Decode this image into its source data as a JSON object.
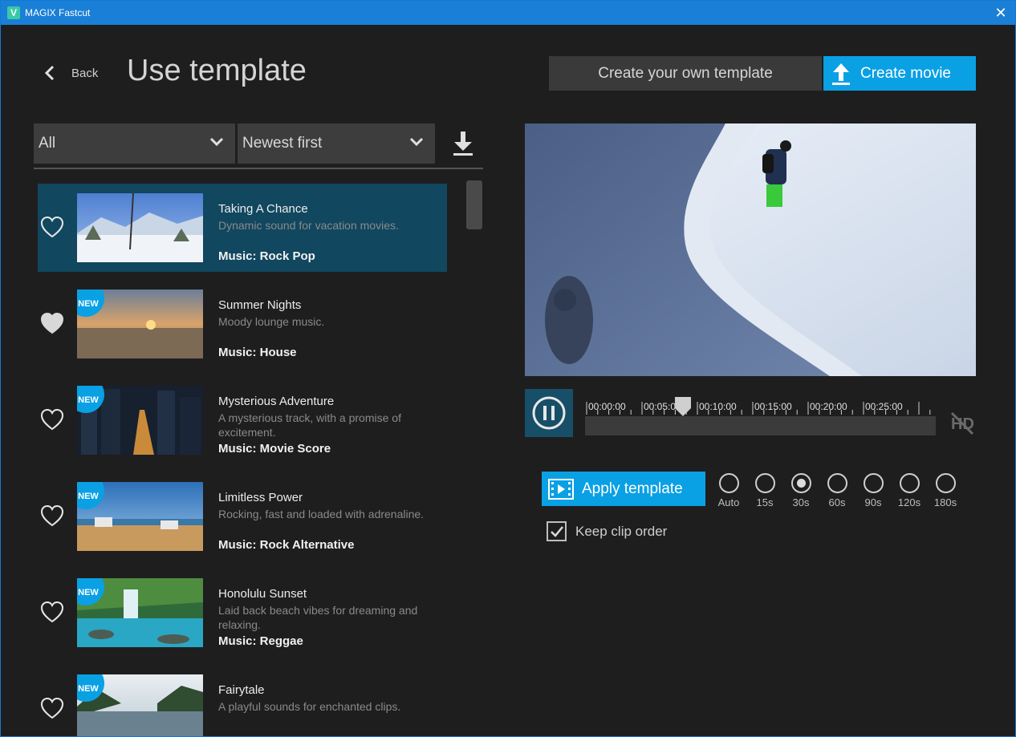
{
  "window": {
    "title": "MAGIX Fastcut",
    "icon_letter": "V",
    "close_glyph": "✕"
  },
  "header": {
    "back_label": "Back",
    "page_title": "Use template",
    "own_template_label": "Create your own template",
    "create_movie_label": "Create movie"
  },
  "filters": {
    "category": "All",
    "sort": "Newest first"
  },
  "templates": [
    {
      "title": "Taking A Chance",
      "desc": "Dynamic sound for vacation movies.",
      "music": "Music: Rock Pop",
      "badge": "",
      "favorite": false,
      "selected": true
    },
    {
      "title": "Summer Nights",
      "desc": "Moody lounge music.",
      "music": "Music: House",
      "badge": "NEW",
      "favorite": true,
      "selected": false
    },
    {
      "title": "Mysterious Adventure",
      "desc": "A mysterious track, with a promise of excitement.",
      "music": "Music: Movie Score",
      "badge": "NEW",
      "favorite": false,
      "selected": false
    },
    {
      "title": "Limitless Power",
      "desc": "Rocking, fast and loaded with adrenaline.",
      "music": "Music: Rock Alternative",
      "badge": "NEW",
      "favorite": false,
      "selected": false
    },
    {
      "title": "Honolulu Sunset",
      "desc": "Laid back beach vibes for dreaming and relaxing.",
      "music": "Music: Reggae",
      "badge": "NEW",
      "favorite": false,
      "selected": false
    },
    {
      "title": "Fairytale",
      "desc": "A playful sounds for enchanted clips.",
      "music": "",
      "badge": "NEW",
      "favorite": false,
      "selected": false
    }
  ],
  "player": {
    "timecodes": [
      "00:00:00",
      "00:05:00",
      "00:10:00",
      "00:15:00",
      "00:20:00",
      "00:25:00"
    ],
    "playhead_fraction": 0.28
  },
  "options": {
    "apply_label": "Apply template",
    "durations": [
      "Auto",
      "15s",
      "30s",
      "60s",
      "90s",
      "120s",
      "180s"
    ],
    "selected_duration": "30s",
    "keep_clip_order_label": "Keep clip order",
    "keep_clip_order_checked": true
  },
  "colors": {
    "accent": "#0aa0e4",
    "selected_row": "#11475f",
    "titlebar": "#1a7fd6"
  }
}
